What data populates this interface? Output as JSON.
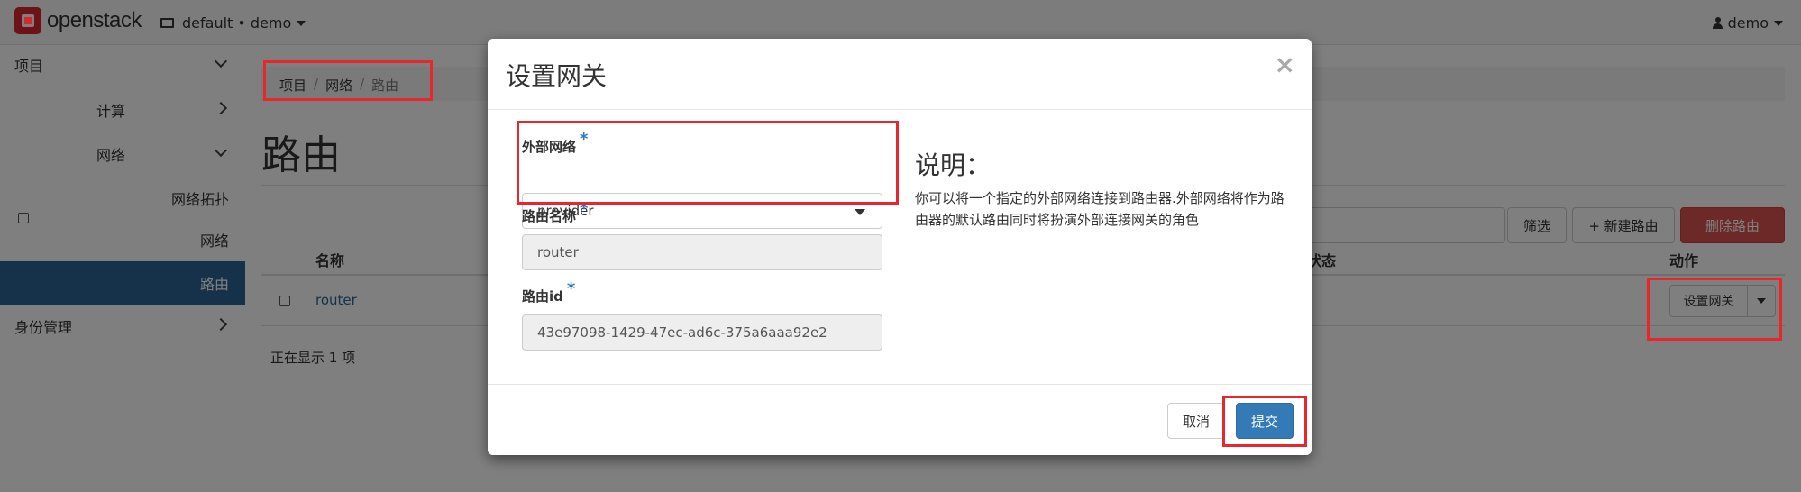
{
  "topbar": {
    "brand": "openstack",
    "project_selector": "default • demo",
    "user_menu": "demo"
  },
  "sidebar": {
    "items": [
      {
        "label": "项目"
      },
      {
        "label": "计算"
      },
      {
        "label": "网络"
      },
      {
        "label": "网络拓扑"
      },
      {
        "label": "网络"
      },
      {
        "label": "路由"
      },
      {
        "label": "身份管理"
      }
    ]
  },
  "breadcrumb": [
    "项目",
    "网络",
    "路由"
  ],
  "page": {
    "title": "路由",
    "filter_button": "筛选",
    "create_button": "+ 新建路由",
    "delete_button": "删除路由",
    "table": {
      "columns": [
        "名称",
        "状态",
        "动作"
      ],
      "rows": [
        {
          "name": "router",
          "action": "设置网关"
        }
      ]
    },
    "footer": "正在显示 1 项"
  },
  "modal": {
    "title": "设置网关",
    "close": "×",
    "fields": {
      "external_network": {
        "label": "外部网络",
        "required": "*",
        "value": "provider"
      },
      "router_name": {
        "label": "路由名称",
        "required": "*",
        "value": "router"
      },
      "router_id": {
        "label": "路由id",
        "required": "*",
        "value": "43e97098-1429-47ec-ad6c-375a6aaa92e2"
      }
    },
    "help": {
      "title": "说明：",
      "text": "你可以将一个指定的外部网络连接到路由器.外部网络将作为路由器的默认路由同时将扮演外部连接网关的角色"
    },
    "cancel_label": "取消",
    "submit_label": "提交"
  },
  "colors": {
    "highlight": "#e8262c",
    "primary": "#337ab7",
    "sidebar_active": "#2c6496",
    "danger": "#d9534f"
  }
}
